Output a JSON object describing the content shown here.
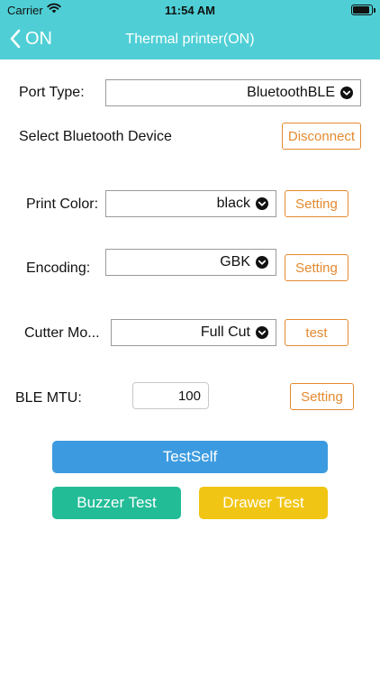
{
  "status_bar": {
    "carrier": "Carrier",
    "time": "11:54 AM"
  },
  "nav": {
    "back_label": "ON",
    "title": "Thermal printer(ON)"
  },
  "port_type": {
    "label": "Port Type:",
    "value": "BluetoothBLE"
  },
  "bluetooth": {
    "label": "Select Bluetooth Device",
    "button": "Disconnect"
  },
  "print_color": {
    "label": "Print Color:",
    "value": "black",
    "button": "Setting"
  },
  "encoding": {
    "label": "Encoding:",
    "value": "GBK",
    "button": "Setting"
  },
  "cutter_mode": {
    "label": "Cutter Mo...",
    "value": "Full Cut",
    "button": "test"
  },
  "ble_mtu": {
    "label": "BLE MTU:",
    "value": "100",
    "button": "Setting"
  },
  "actions": {
    "test_self": "TestSelf",
    "buzzer_test": "Buzzer Test",
    "drawer_test": "Drawer Test"
  },
  "colors": {
    "header": "#4fcfd5",
    "accent_orange": "#e48a2f",
    "test_self": "#3c9be0",
    "buzzer": "#22bc97",
    "drawer": "#f1c513"
  },
  "icons": {
    "back": "chevron-left-icon",
    "dropdown": "chevron-down-circle-icon",
    "wifi": "wifi-icon",
    "battery": "battery-icon"
  }
}
